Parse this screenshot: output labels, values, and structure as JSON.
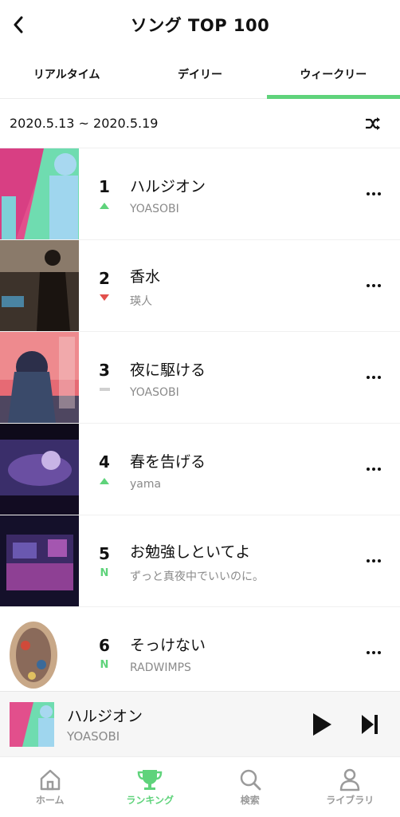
{
  "header": {
    "title": "ソング TOP 100"
  },
  "tabs": [
    {
      "label": "リアルタイム",
      "active": false
    },
    {
      "label": "デイリー",
      "active": false
    },
    {
      "label": "ウィークリー",
      "active": true
    }
  ],
  "date_range": "2020.5.13 ~ 2020.5.19",
  "songs": [
    {
      "rank": "1",
      "title": "ハルジオン",
      "artist": "YOASOBI",
      "change": "up"
    },
    {
      "rank": "2",
      "title": "香水",
      "artist": "瑛人",
      "change": "down"
    },
    {
      "rank": "3",
      "title": "夜に駆ける",
      "artist": "YOASOBI",
      "change": "same"
    },
    {
      "rank": "4",
      "title": "春を告げる",
      "artist": "yama",
      "change": "up"
    },
    {
      "rank": "5",
      "title": "お勉強しといてよ",
      "artist": "ずっと真夜中でいいのに。",
      "change": "new",
      "change_label": "N"
    },
    {
      "rank": "6",
      "title": "そっけない",
      "artist": "RADWIMPS",
      "change": "new",
      "change_label": "N"
    }
  ],
  "player": {
    "title": "ハルジオン",
    "artist": "YOASOBI"
  },
  "bottom_nav": [
    {
      "label": "ホーム",
      "icon": "home-icon",
      "active": false
    },
    {
      "label": "ランキング",
      "icon": "trophy-icon",
      "active": true
    },
    {
      "label": "検索",
      "icon": "search-icon",
      "active": false
    },
    {
      "label": "ライブラリ",
      "icon": "person-icon",
      "active": false
    }
  ],
  "colors": {
    "accent": "#5fd37b",
    "down": "#e2504c",
    "same": "#d0d0d0"
  }
}
